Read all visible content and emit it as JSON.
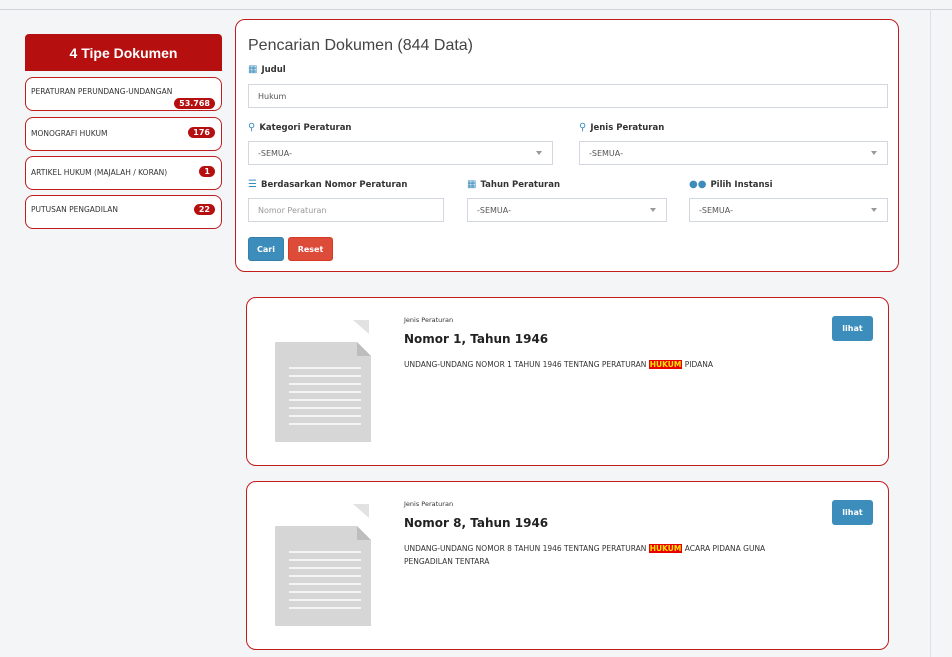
{
  "sidebar": {
    "title": "4 Tipe Dokumen",
    "items": [
      {
        "label": "PERATURAN PERUNDANG-UNDANGAN",
        "count": "53.768"
      },
      {
        "label": "MONOGRAFI HUKUM",
        "count": "176"
      },
      {
        "label": "ARTIKEL HUKUM (MAJALAH / KORAN)",
        "count": "1"
      },
      {
        "label": "PUTUSAN PENGADILAN",
        "count": "22"
      }
    ]
  },
  "search": {
    "title": "Pencarian Dokumen (844 Data)",
    "judul_label": "Judul",
    "judul_value": "Hukum",
    "kategori_label": "Kategori Peraturan",
    "kategori_value": "-SEMUA-",
    "jenis_label": "Jenis Peraturan",
    "jenis_value": "-SEMUA-",
    "nomor_label": "Berdasarkan Nomor Peraturan",
    "nomor_placeholder": "Nomor Peraturan",
    "tahun_label": "Tahun Peraturan",
    "tahun_value": "-SEMUA-",
    "instansi_label": "Pilih Instansi",
    "instansi_value": "-SEMUA-",
    "cari_label": "Cari",
    "reset_label": "Reset"
  },
  "results": [
    {
      "jenis": "Jenis Peraturan",
      "nomor": "Nomor 1, Tahun 1946",
      "desc_before": "UNDANG-UNDANG NOMOR 1 TAHUN 1946 TENTANG PERATURAN ",
      "highlight": "HUKUM",
      "desc_after": " PIDANA",
      "lihat": "lihat"
    },
    {
      "jenis": "Jenis Peraturan",
      "nomor": "Nomor 8, Tahun 1946",
      "desc_before": "UNDANG-UNDANG NOMOR 8 TAHUN 1946 TENTANG PERATURAN ",
      "highlight": "HUKUM",
      "desc_after": " ACARA PIDANA GUNA PENGADILAN TENTARA",
      "lihat": "lihat"
    }
  ],
  "colors": {
    "accent_red": "#b50f0f",
    "border_red": "#c21d1d",
    "primary_blue": "#3c8dbc",
    "reset_red": "#dd4b39",
    "highlight_bg": "#e80000",
    "highlight_text": "#ffe800"
  }
}
